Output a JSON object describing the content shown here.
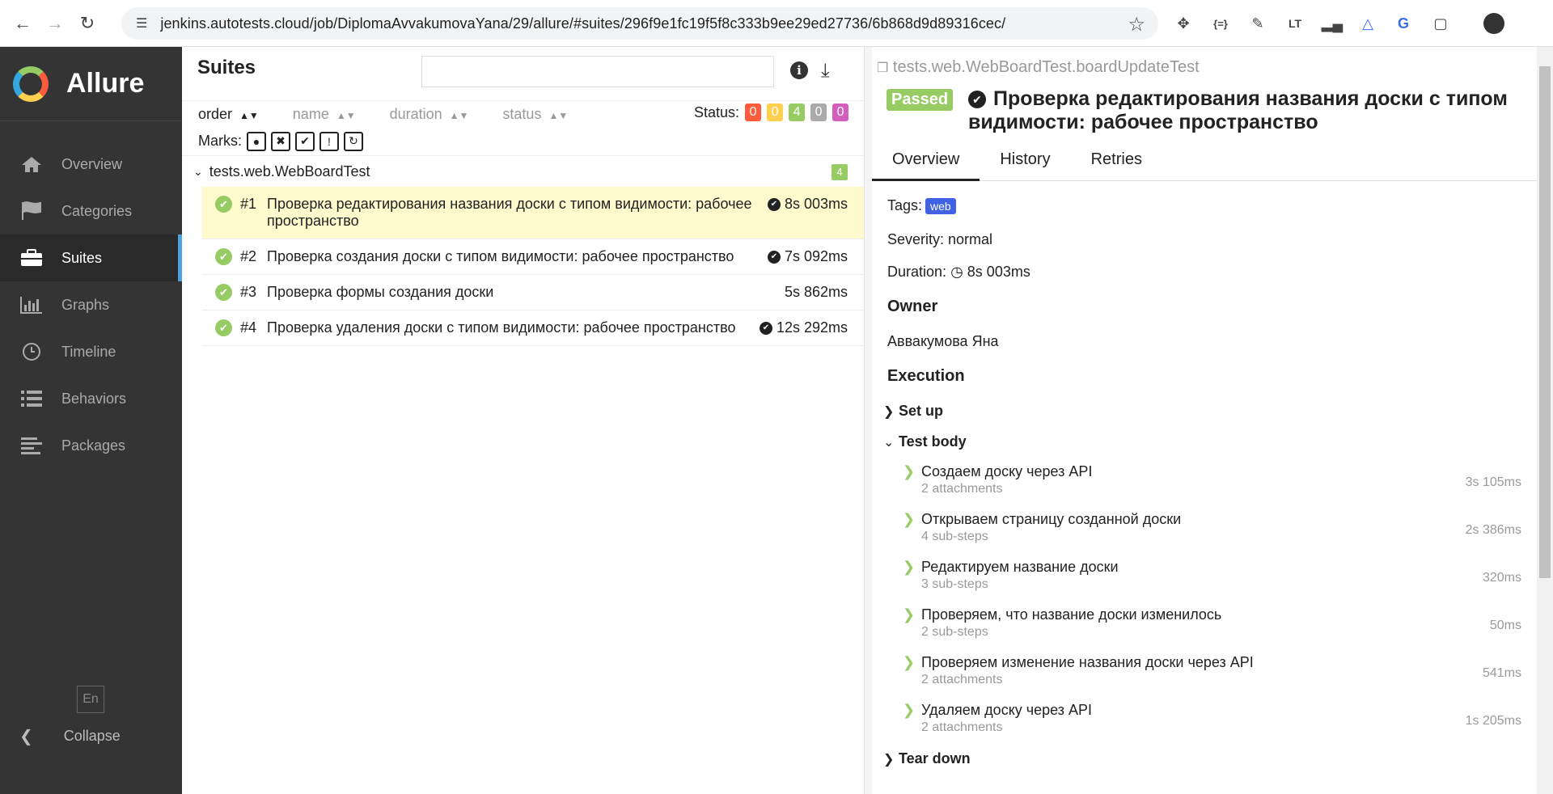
{
  "browser": {
    "url": "jenkins.autotests.cloud/job/DiplomaAvvakumovaYana/29/allure/#suites/296f9e1fc19f5f8c333b9ee29ed27736/6b868d9d89316cec/"
  },
  "sidebar": {
    "brand": "Allure",
    "items": [
      {
        "label": "Overview",
        "icon": "home-icon"
      },
      {
        "label": "Categories",
        "icon": "flag-icon"
      },
      {
        "label": "Suites",
        "icon": "briefcase-icon"
      },
      {
        "label": "Graphs",
        "icon": "bar-chart-icon"
      },
      {
        "label": "Timeline",
        "icon": "clock-icon"
      },
      {
        "label": "Behaviors",
        "icon": "list-icon"
      },
      {
        "label": "Packages",
        "icon": "align-left-icon"
      }
    ],
    "active": "Suites",
    "lang": "En",
    "collapse": "Collapse"
  },
  "suites": {
    "title": "Suites",
    "sort": {
      "order": "order",
      "name": "name",
      "duration": "duration",
      "status": "status"
    },
    "status_label": "Status:",
    "status_counts": [
      {
        "value": "0",
        "color": "#fd5a3e"
      },
      {
        "value": "0",
        "color": "#ffd050"
      },
      {
        "value": "4",
        "color": "#97cc64"
      },
      {
        "value": "0",
        "color": "#aaaaaa"
      },
      {
        "value": "0",
        "color": "#d35ebe"
      }
    ],
    "marks_label": "Marks:",
    "group": {
      "name": "tests.web.WebBoardTest",
      "count": "4"
    },
    "tests": [
      {
        "num": "#1",
        "name": "Проверка редактирования названия доски с типом видимости: рабочее пространство",
        "duration": "8s 003ms"
      },
      {
        "num": "#2",
        "name": "Проверка создания доски с типом видимости: рабочее пространство",
        "duration": "7s 092ms"
      },
      {
        "num": "#3",
        "name": "Проверка формы создания доски",
        "duration": "5s 862ms"
      },
      {
        "num": "#4",
        "name": "Проверка удаления доски с типом видимости: рабочее пространство",
        "duration": "12s 292ms"
      }
    ]
  },
  "detail": {
    "crumb": "tests.web.WebBoardTest.boardUpdateTest",
    "status": "Passed",
    "title": "Проверка редактирования названия доски с типом видимости: рабочее пространство",
    "tabs": [
      "Overview",
      "History",
      "Retries"
    ],
    "tags_label": "Tags:",
    "tag": "web",
    "severity": "Severity: normal",
    "duration_label": "Duration:",
    "duration": "8s 003ms",
    "owner_heading": "Owner",
    "owner": "Аввакумова Яна",
    "execution_heading": "Execution",
    "setup": "Set up",
    "test_body": "Test body",
    "teardown": "Tear down",
    "steps": [
      {
        "name": "Создаем доску через API",
        "sub": "2 attachments",
        "duration": "3s 105ms"
      },
      {
        "name": "Открываем страницу созданной доски",
        "sub": "4 sub-steps",
        "duration": "2s 386ms"
      },
      {
        "name": "Редактируем название доски",
        "sub": "3 sub-steps",
        "duration": "320ms"
      },
      {
        "name": "Проверяем, что название доски изменилось",
        "sub": "2 sub-steps",
        "duration": "50ms"
      },
      {
        "name": "Проверяем изменение названия доски через API",
        "sub": "2 attachments",
        "duration": "541ms"
      },
      {
        "name": "Удаляем доску через API",
        "sub": "2 attachments",
        "duration": "1s 205ms"
      }
    ]
  }
}
